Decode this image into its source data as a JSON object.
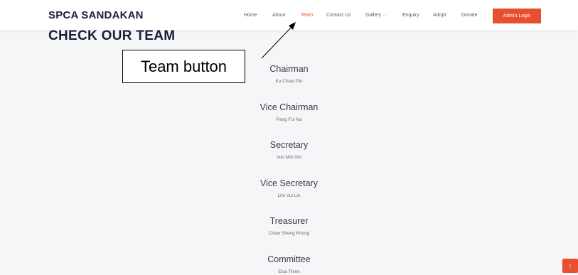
{
  "header": {
    "logo": "SPCA SANDAKAN",
    "nav": [
      {
        "label": "Home"
      },
      {
        "label": "About"
      },
      {
        "label": "Team"
      },
      {
        "label": "Contact Us"
      },
      {
        "label": "Gallery"
      },
      {
        "label": "Enquiry"
      },
      {
        "label": "Adopt"
      },
      {
        "label": "Donate"
      }
    ],
    "gallery_chevron": "⌵",
    "admin_button": "Admin Login"
  },
  "section": {
    "title": "CHECK OUR TEAM"
  },
  "team": [
    {
      "role": "Chairman",
      "name": "Ku Chiau Pin"
    },
    {
      "role": "Vice Chairman",
      "name": "Pang Fui Na"
    },
    {
      "role": "Secretary",
      "name": "Voo Min Gin"
    },
    {
      "role": "Vice Secretary",
      "name": "Lim Vui Lin"
    },
    {
      "role": "Treasurer",
      "name": "Chew Sheng Khong"
    },
    {
      "role": "Committee",
      "name": "Elsa Thien"
    }
  ],
  "annotation": {
    "label": "Team button"
  },
  "back_to_top": "↑",
  "colors": {
    "accent": "#e84f2e",
    "heading": "#1a1f36",
    "background": "#f5f6f8"
  }
}
